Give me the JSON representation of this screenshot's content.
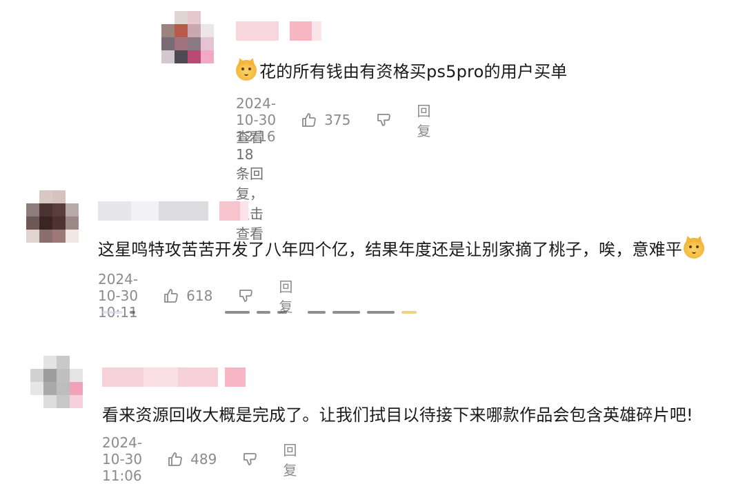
{
  "comments": [
    {
      "text": "花的所有钱由有资格买ps5pro的用户买单",
      "has_emoji_prefix": true,
      "time": "2024-10-30 12:16",
      "likes": "375",
      "reply_label": "回复",
      "view_replies": "查看 18 条回复，点击查看"
    },
    {
      "text": "这星鸣特攻苦苦开发了八年四个亿，结果年度还是让别家摘了桃子，唉，意难平",
      "has_emoji_suffix": true,
      "time": "2024-10-30 10:11",
      "likes": "618",
      "reply_label": "回复"
    },
    {
      "text": "看来资源回收大概是完成了。让我们拭目以待接下来哪款作品会包含英雄碎片吧!",
      "time": "2024-10-30 11:06",
      "likes": "489",
      "reply_label": "回复"
    }
  ],
  "icons": {
    "like": "thumbs-up-icon",
    "dislike": "thumbs-down-icon",
    "emoji": "cat-face-emoji-icon"
  },
  "colors": {
    "meta_text": "#8a8a8a",
    "avatar_blur_pink": "#f4a3b5"
  }
}
